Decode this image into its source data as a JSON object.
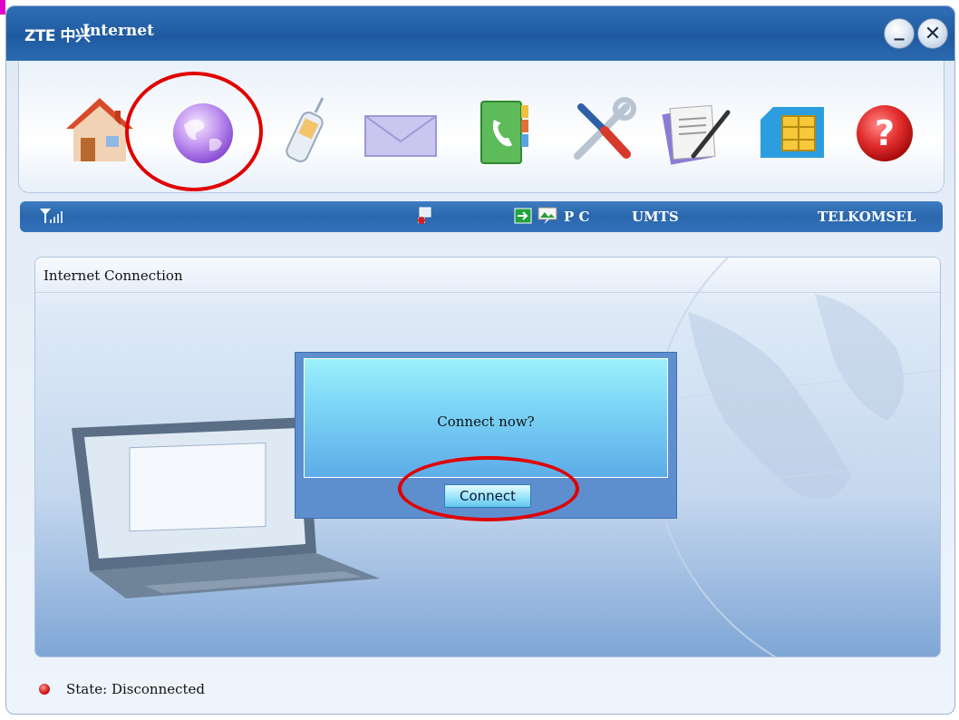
{
  "window": {
    "brand": "ZTE 中兴",
    "app_name": "Internet"
  },
  "title_buttons": {
    "minimize": "_",
    "close": "✕"
  },
  "toolbar": {
    "items": [
      {
        "name": "home",
        "icon": "home-icon"
      },
      {
        "name": "internet",
        "icon": "globe-icon",
        "selected": true
      },
      {
        "name": "phone",
        "icon": "phone-icon"
      },
      {
        "name": "sms",
        "icon": "envelope-icon"
      },
      {
        "name": "phonebook",
        "icon": "phonebook-icon"
      },
      {
        "name": "settings",
        "icon": "tools-icon"
      },
      {
        "name": "notes",
        "icon": "notepad-icon"
      },
      {
        "name": "sim",
        "icon": "sim-card-icon"
      },
      {
        "name": "help",
        "icon": "help-icon"
      }
    ]
  },
  "status": {
    "mode": "P C",
    "network_type": "UMTS",
    "operator": "TELKOMSEL"
  },
  "panel": {
    "title": "Internet Connection",
    "dialog_message": "Connect now?",
    "connect_label": "Connect"
  },
  "state": {
    "text": "State: Disconnected"
  },
  "colors": {
    "accent": "#2a67ad",
    "annotation": "#e00000",
    "state_led": "#d71a1a"
  }
}
